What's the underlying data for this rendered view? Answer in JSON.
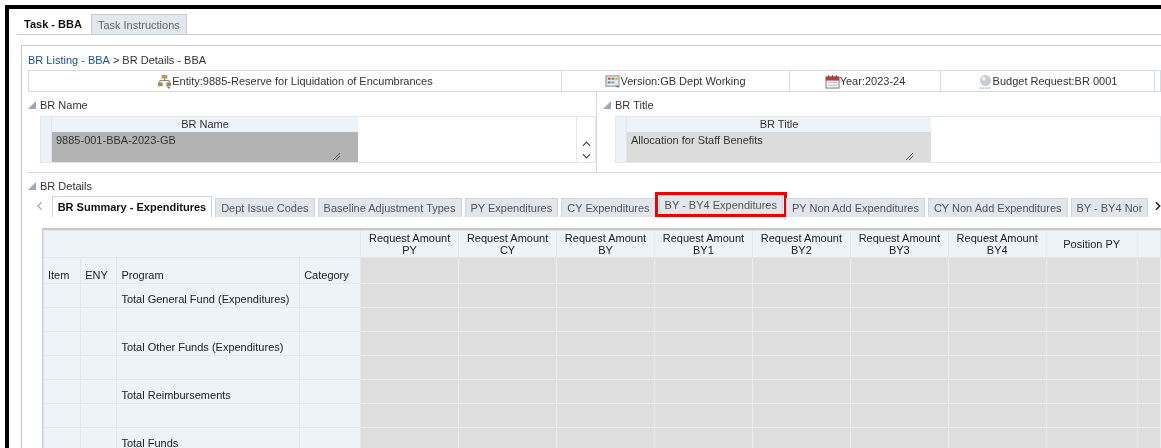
{
  "task_tabs": [
    {
      "label": "Task - BBA",
      "selected": true
    },
    {
      "label": "Task Instructions",
      "selected": false
    }
  ],
  "breadcrumb": {
    "link": "BR Listing - BBA",
    "separator": ">",
    "current": "BR Details - BBA"
  },
  "info_bar": [
    {
      "kind": "entity",
      "label": "Entity:9885-Reserve for Liquidation of Encumbrances"
    },
    {
      "kind": "version",
      "label": "Version:GB Dept Working"
    },
    {
      "kind": "year",
      "label": "Year:2023-24"
    },
    {
      "kind": "request",
      "label": "Budget Request:BR 0001"
    }
  ],
  "sections": [
    {
      "title": "BR Name",
      "column": "BR Name",
      "value": "9885-001-BBA-2023-GB",
      "scrollable": true
    },
    {
      "title": "BR Title",
      "column": "BR Title",
      "value": "Allocation for Staff Benefits",
      "scrollable": false
    }
  ],
  "details": {
    "title": "BR Details",
    "tabs": [
      {
        "label": "BR Summary - Expenditures",
        "selected": true,
        "highlighted": false
      },
      {
        "label": "Dept Issue Codes",
        "selected": false,
        "highlighted": false
      },
      {
        "label": "Baseline Adjustment Types",
        "selected": false,
        "highlighted": false
      },
      {
        "label": "PY Expenditures",
        "selected": false,
        "highlighted": false
      },
      {
        "label": "CY Expenditures",
        "selected": false,
        "highlighted": false
      },
      {
        "label": "BY - BY4 Expenditures",
        "selected": false,
        "highlighted": true
      },
      {
        "label": "PY Non Add Expenditures",
        "selected": false,
        "highlighted": false
      },
      {
        "label": "CY Non Add Expenditures",
        "selected": false,
        "highlighted": false
      },
      {
        "label": "BY - BY4 Nor",
        "selected": false,
        "highlighted": false
      }
    ],
    "row_columns": [
      "Item",
      "ENY",
      "Program",
      "Category"
    ],
    "amount_columns": [
      [
        "Request Amount",
        "PY"
      ],
      [
        "Request Amount",
        "CY"
      ],
      [
        "Request Amount",
        "BY"
      ],
      [
        "Request Amount",
        "BY1"
      ],
      [
        "Request Amount",
        "BY2"
      ],
      [
        "Request Amount",
        "BY3"
      ],
      [
        "Request Amount",
        "BY4"
      ],
      [
        "Position PY"
      ]
    ],
    "rows": [
      {
        "kind": "total",
        "program": "Total General Fund (Expenditures)"
      },
      {
        "kind": "spacer"
      },
      {
        "kind": "total",
        "program": "Total Other Funds (Expenditures)"
      },
      {
        "kind": "spacer"
      },
      {
        "kind": "total",
        "program": "Total Reimbursements"
      },
      {
        "kind": "spacer"
      },
      {
        "kind": "total",
        "program": "Total Funds"
      }
    ]
  }
}
